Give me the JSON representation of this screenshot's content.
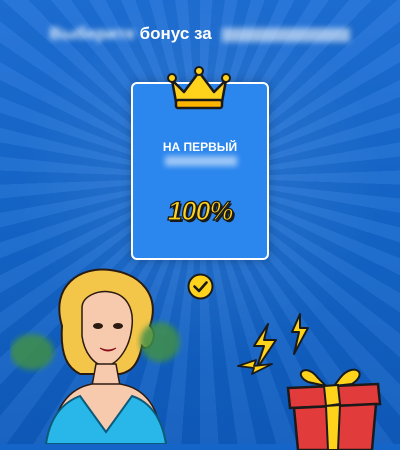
{
  "header": {
    "title_blurred": "Выберите",
    "title_word": "бонус за",
    "title_tail_blurred": ""
  },
  "bonus_card": {
    "title": "НА ПЕРВЫЙ",
    "subtitle_blurred": "",
    "percent": "100%"
  },
  "icons": {
    "crown": "crown-icon",
    "check": "checkmark-circle-icon",
    "lightning": "lightning-icon",
    "gift": "gift-box-icon"
  },
  "colors": {
    "background": "#1565c8",
    "card": "#2b86ee",
    "accent_yellow": "#ffd21c",
    "gift_red": "#e23b3b"
  }
}
